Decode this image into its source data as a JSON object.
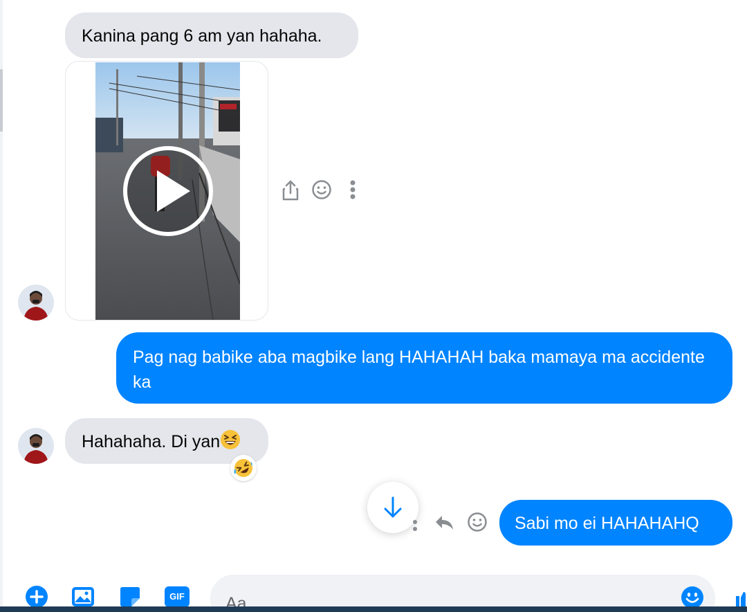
{
  "colors": {
    "outgoing_bubble": "#0084ff",
    "incoming_bubble": "#e4e6eb",
    "accent": "#0084ff",
    "icon_gray": "#8a8d91"
  },
  "messages": [
    {
      "sender": "contact",
      "type": "text",
      "text": "Kanina pang 6 am yan hahaha."
    },
    {
      "sender": "contact",
      "type": "video"
    },
    {
      "sender": "me",
      "type": "text",
      "text": "Pag nag babike aba magbike lang HAHAHAH baka mamaya ma accidente ka"
    },
    {
      "sender": "contact",
      "type": "text",
      "text": "Hahahaha. Di yan",
      "emoji": "grinning-squinting-face",
      "reaction": "rolling-on-floor-laughing"
    },
    {
      "sender": "me",
      "type": "text",
      "text": "Sabi mo ei HAHAHAHQ"
    }
  ],
  "video_actions": [
    "share-icon",
    "react-icon",
    "more-options-icon"
  ],
  "hover_actions": [
    "more-options-icon",
    "reply-icon",
    "react-icon"
  ],
  "composer": {
    "placeholder": "Aa",
    "buttons": [
      "plus-icon",
      "photo-icon",
      "sticker-icon",
      "gif-icon"
    ],
    "gif_label": "GIF",
    "emoji_button": "smiley-icon"
  },
  "scroll_button": "arrow-down-icon"
}
